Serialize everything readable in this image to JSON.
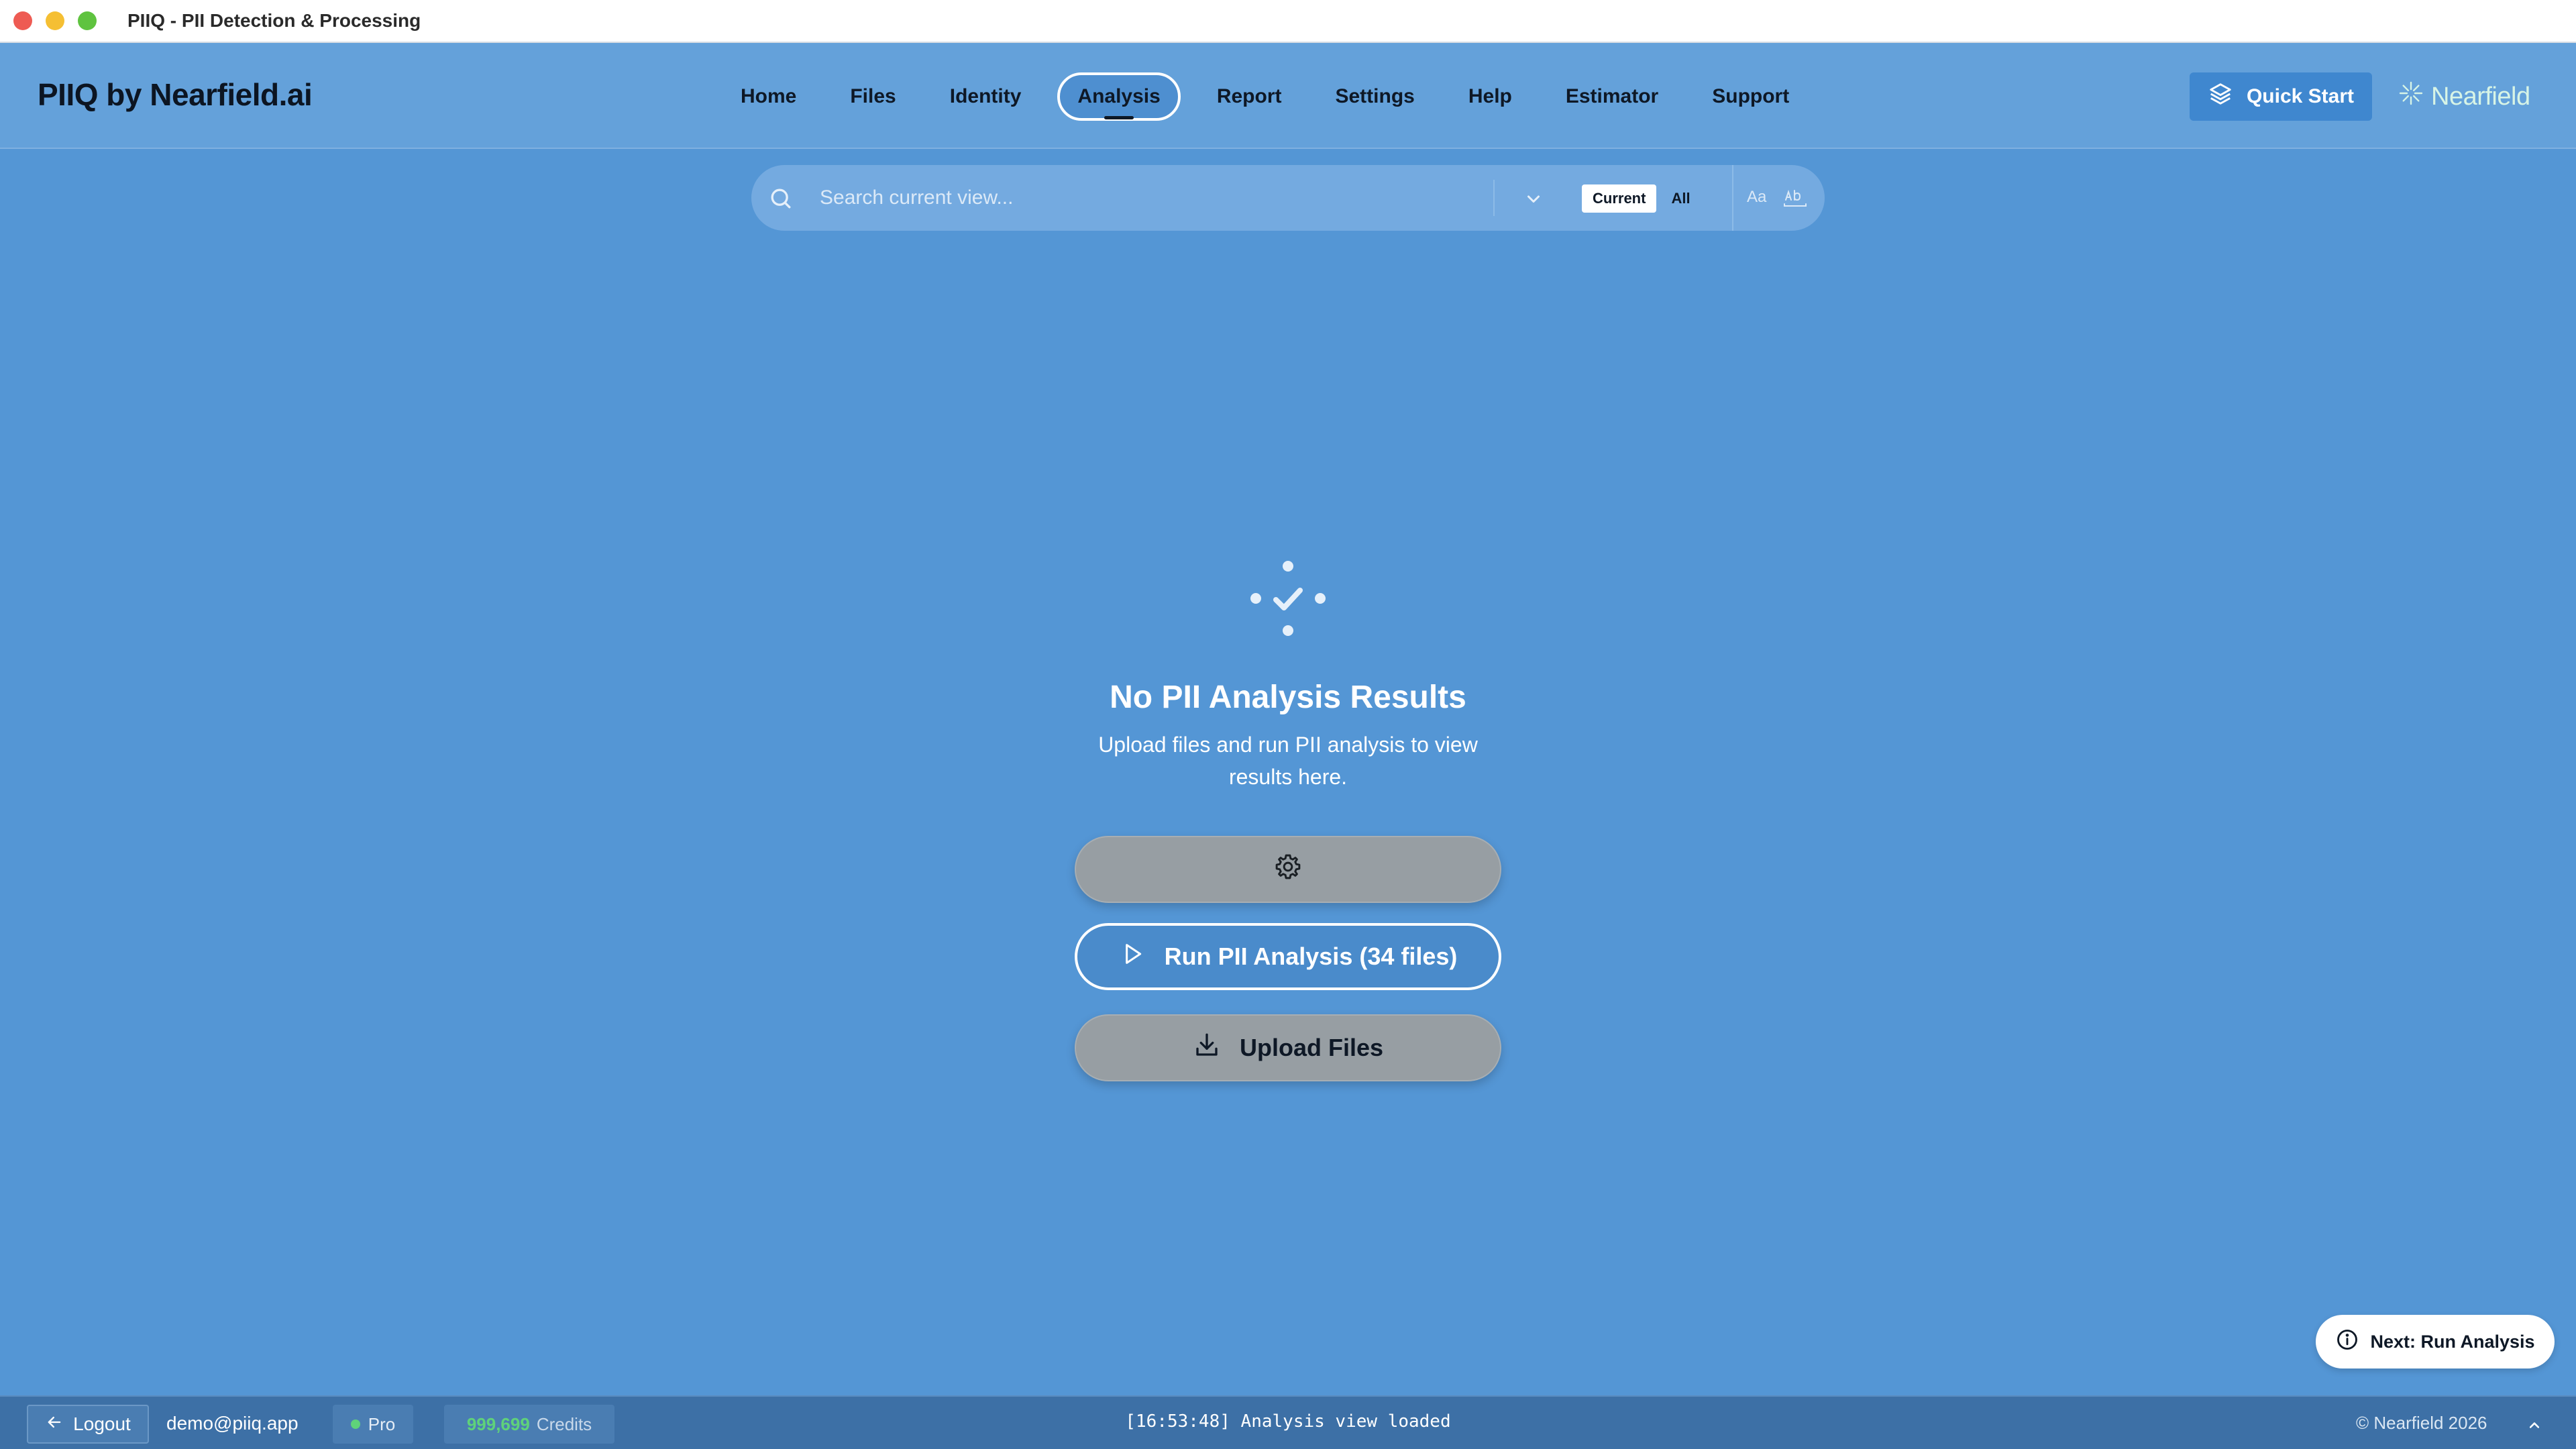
{
  "window": {
    "title": "PIIQ - PII Detection & Processing"
  },
  "header": {
    "brand": "PIIQ by Nearfield.ai",
    "nav": [
      {
        "label": "Home",
        "active": false
      },
      {
        "label": "Files",
        "active": false
      },
      {
        "label": "Identity",
        "active": false
      },
      {
        "label": "Analysis",
        "active": true
      },
      {
        "label": "Report",
        "active": false
      },
      {
        "label": "Settings",
        "active": false
      },
      {
        "label": "Help",
        "active": false
      },
      {
        "label": "Estimator",
        "active": false
      },
      {
        "label": "Support",
        "active": false
      }
    ],
    "quick_start_label": "Quick Start",
    "logo_text": "Nearfield"
  },
  "search": {
    "placeholder": "Search current view...",
    "value": "",
    "scope_current": "Current",
    "scope_all": "All",
    "scope_selected": "Current",
    "match_case_label": "Aa"
  },
  "empty_state": {
    "title": "No PII Analysis Results",
    "subtitle": "Upload files and run PII analysis to view results here.",
    "run_button_label": "Run PII Analysis (34 files)",
    "upload_button_label": "Upload Files"
  },
  "next_hint": {
    "label": "Next: Run Analysis"
  },
  "status_bar": {
    "logout_label": "Logout",
    "user_email": "demo@piiq.app",
    "plan": "Pro",
    "credits_value": "999,699",
    "credits_label": "Credits",
    "log_message": "[16:53:48] Analysis view loaded",
    "copyright": "© Nearfield 2026"
  },
  "colors": {
    "background": "#5496d5",
    "header": "#64a1da",
    "status_bar": "#3d70a6",
    "credits_accent": "#5fd27a",
    "logo": "#d7f4e6"
  }
}
